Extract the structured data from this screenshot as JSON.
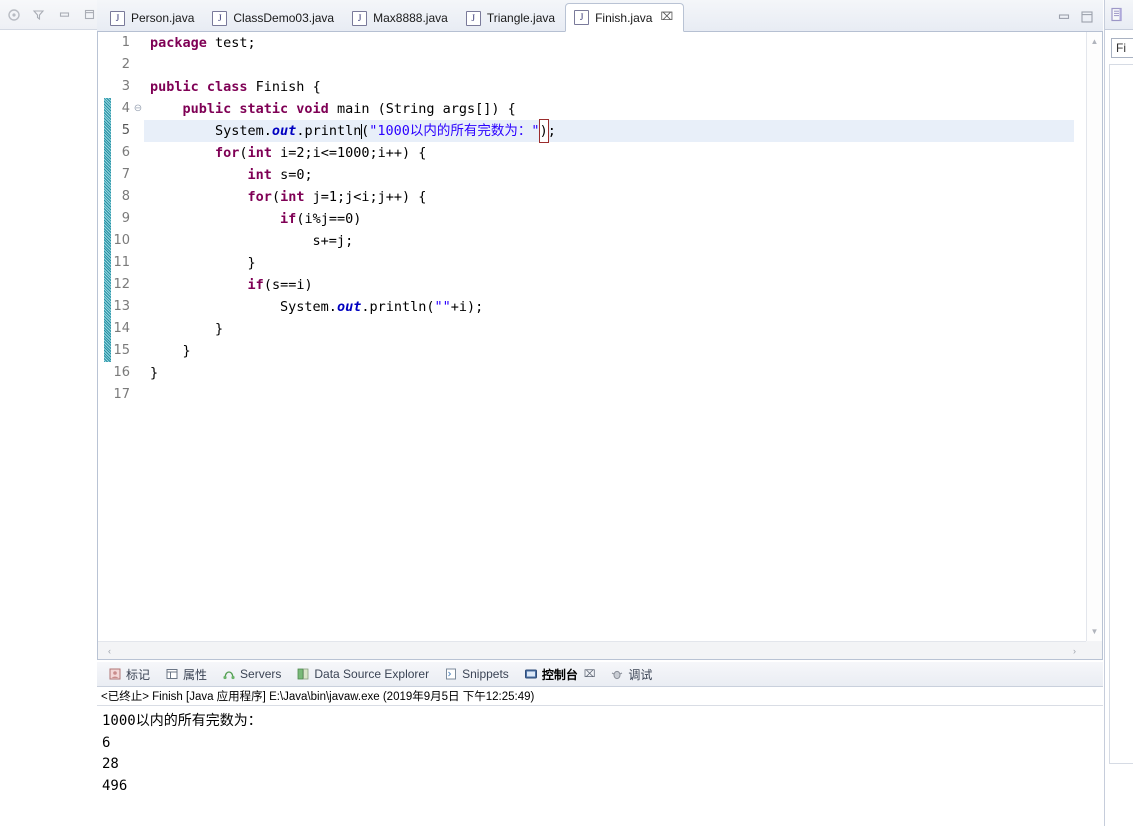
{
  "window": {
    "left_toolbar_icons": [
      "view-menu-icon",
      "filter-icon",
      "minimize-icon",
      "maximize-icon"
    ]
  },
  "editor": {
    "tabs": [
      {
        "label": "Person.java",
        "icon": "java-file-icon",
        "active": false,
        "closable": false
      },
      {
        "label": "ClassDemo03.java",
        "icon": "java-file-icon",
        "active": false,
        "closable": false
      },
      {
        "label": "Max8888.java",
        "icon": "java-file-icon",
        "active": false,
        "closable": false
      },
      {
        "label": "Triangle.java",
        "icon": "java-file-icon",
        "active": false,
        "closable": false
      },
      {
        "label": "Finish.java",
        "icon": "java-file-icon",
        "active": true,
        "closable": true,
        "close_glyph": "⌧"
      }
    ],
    "right_icons": [
      "minimize-icon",
      "maximize-icon"
    ],
    "java_icon_letter": "J",
    "scroll": {
      "up_arrow": "▲",
      "down_arrow": "▼",
      "left_arrow": "‹",
      "right_arrow": "›"
    },
    "fold_marker": "⊖",
    "lines": [
      {
        "n": "1",
        "fold": "",
        "highlight": false,
        "tokens": [
          {
            "t": "package ",
            "c": "kw"
          },
          {
            "t": "test;",
            "c": "pln"
          }
        ]
      },
      {
        "n": "2",
        "fold": "",
        "highlight": false,
        "tokens": []
      },
      {
        "n": "3",
        "fold": "",
        "highlight": false,
        "tokens": [
          {
            "t": "public class ",
            "c": "kw"
          },
          {
            "t": "Finish {",
            "c": "pln"
          }
        ]
      },
      {
        "n": "4",
        "fold": "⊖",
        "highlight": false,
        "tokens": [
          {
            "t": "    ",
            "c": "pln"
          },
          {
            "t": "public static void ",
            "c": "kw"
          },
          {
            "t": "main (String args[]) {",
            "c": "pln"
          }
        ]
      },
      {
        "n": "5",
        "fold": "",
        "highlight": true,
        "tokens": [
          {
            "t": "        System.",
            "c": "pln"
          },
          {
            "t": "out",
            "c": "fld"
          },
          {
            "t": ".println",
            "c": "pln"
          },
          {
            "t": "|",
            "c": "caret"
          },
          {
            "t": "(",
            "c": "pln"
          },
          {
            "t": "\"1000以内的所有完数为：\"",
            "c": "str"
          },
          {
            "t": ")",
            "c": "bracket"
          },
          {
            "t": ";",
            "c": "pln"
          }
        ]
      },
      {
        "n": "6",
        "fold": "",
        "highlight": false,
        "tokens": [
          {
            "t": "        ",
            "c": "pln"
          },
          {
            "t": "for",
            "c": "kw"
          },
          {
            "t": "(",
            "c": "pln"
          },
          {
            "t": "int ",
            "c": "kw"
          },
          {
            "t": "i=2;i<=1000;i++) {",
            "c": "pln"
          }
        ]
      },
      {
        "n": "7",
        "fold": "",
        "highlight": false,
        "tokens": [
          {
            "t": "            ",
            "c": "pln"
          },
          {
            "t": "int ",
            "c": "kw"
          },
          {
            "t": "s=0;",
            "c": "pln"
          }
        ]
      },
      {
        "n": "8",
        "fold": "",
        "highlight": false,
        "tokens": [
          {
            "t": "            ",
            "c": "pln"
          },
          {
            "t": "for",
            "c": "kw"
          },
          {
            "t": "(",
            "c": "pln"
          },
          {
            "t": "int ",
            "c": "kw"
          },
          {
            "t": "j=1;j<i;j++) {",
            "c": "pln"
          }
        ]
      },
      {
        "n": "9",
        "fold": "",
        "highlight": false,
        "tokens": [
          {
            "t": "                ",
            "c": "pln"
          },
          {
            "t": "if",
            "c": "kw"
          },
          {
            "t": "(i%j==0)",
            "c": "pln"
          }
        ]
      },
      {
        "n": "10",
        "fold": "",
        "highlight": false,
        "tokens": [
          {
            "t": "                    s+=j;",
            "c": "pln"
          }
        ]
      },
      {
        "n": "11",
        "fold": "",
        "highlight": false,
        "tokens": [
          {
            "t": "            }",
            "c": "pln"
          }
        ]
      },
      {
        "n": "12",
        "fold": "",
        "highlight": false,
        "tokens": [
          {
            "t": "            ",
            "c": "pln"
          },
          {
            "t": "if",
            "c": "kw"
          },
          {
            "t": "(s==i)",
            "c": "pln"
          }
        ]
      },
      {
        "n": "13",
        "fold": "",
        "highlight": false,
        "tokens": [
          {
            "t": "                System.",
            "c": "pln"
          },
          {
            "t": "out",
            "c": "fld"
          },
          {
            "t": ".println(",
            "c": "pln"
          },
          {
            "t": "\"\"",
            "c": "str"
          },
          {
            "t": "+i);",
            "c": "pln"
          }
        ]
      },
      {
        "n": "14",
        "fold": "",
        "highlight": false,
        "tokens": [
          {
            "t": "        }",
            "c": "pln"
          }
        ]
      },
      {
        "n": "15",
        "fold": "",
        "highlight": false,
        "tokens": [
          {
            "t": "    }",
            "c": "pln"
          }
        ]
      },
      {
        "n": "16",
        "fold": "",
        "highlight": false,
        "tokens": [
          {
            "t": "}",
            "c": "pln"
          }
        ]
      },
      {
        "n": "17",
        "fold": "",
        "highlight": false,
        "tokens": []
      }
    ]
  },
  "console": {
    "tabs": [
      {
        "label": "标记",
        "icon": "markers-icon",
        "active": false,
        "closable": false
      },
      {
        "label": "属性",
        "icon": "properties-icon",
        "active": false,
        "closable": false
      },
      {
        "label": "Servers",
        "icon": "servers-icon",
        "active": false,
        "closable": false
      },
      {
        "label": "Data Source Explorer",
        "icon": "data-source-icon",
        "active": false,
        "closable": false
      },
      {
        "label": "Snippets",
        "icon": "snippets-icon",
        "active": false,
        "closable": false
      },
      {
        "label": "控制台",
        "icon": "console-icon",
        "active": true,
        "closable": true,
        "close_glyph": "⌧"
      },
      {
        "label": "调试",
        "icon": "debug-icon",
        "active": false,
        "closable": false
      }
    ],
    "status_line": "<已终止> Finish [Java 应用程序] E:\\Java\\bin\\javaw.exe  (2019年9月5日 下午12:25:49)",
    "output": "1000以内的所有完数为：\n6\n28\n496"
  },
  "right_panel": {
    "tab_icon": "outline-icon",
    "filter_value": "Fi"
  },
  "colors": {
    "keyword": "#7f0055",
    "string": "#2a00ff",
    "field": "#0000c0",
    "line_highlight": "#e8eff9",
    "change_bar": "#1a8a9e",
    "tab_active_bg": "#ffffff"
  }
}
